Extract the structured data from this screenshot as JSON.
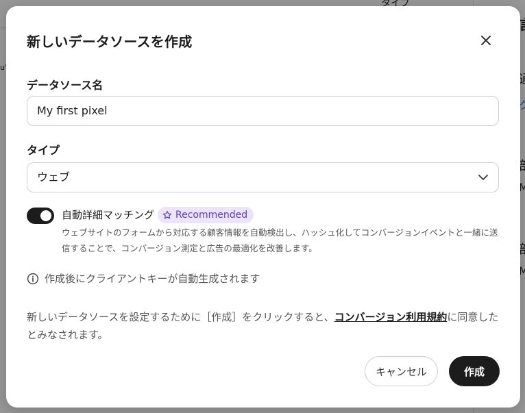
{
  "background": {
    "fragments": [
      "タイプ",
      "u'",
      "言",
      "通",
      "ク",
      "部",
      "M",
      "部",
      "M"
    ]
  },
  "modal": {
    "title": "新しいデータソースを作成",
    "close_icon": "close-icon",
    "name_field": {
      "label": "データソース名",
      "value": "My first pixel"
    },
    "type_field": {
      "label": "タイプ",
      "selected": "ウェブ",
      "chevron_icon": "chevron-down-icon"
    },
    "auto_matching": {
      "enabled": true,
      "label": "自動詳細マッチング",
      "badge": "Recommended",
      "badge_icon": "star-icon",
      "description": "ウェブサイトのフォームから対応する顧客情報を自動検出し、ハッシュ化してコンバージョンイベントと一緒に送信することで、コンバージョン測定と広告の最適化を改善します。"
    },
    "info": {
      "icon": "info-icon",
      "text": "作成後にクライアントキーが自動生成されます"
    },
    "consent": {
      "before": "新しいデータソースを設定するために［作成］をクリックすると、",
      "link": "コンバージョン利用規約",
      "after": "に同意したとみなされます。"
    },
    "buttons": {
      "cancel": "キャンセル",
      "create": "作成"
    }
  },
  "colors": {
    "primary": "#1c1c1c",
    "badge_bg": "#ece4fb",
    "badge_text": "#5b3bb5",
    "overlay": "#9a9a9a"
  }
}
